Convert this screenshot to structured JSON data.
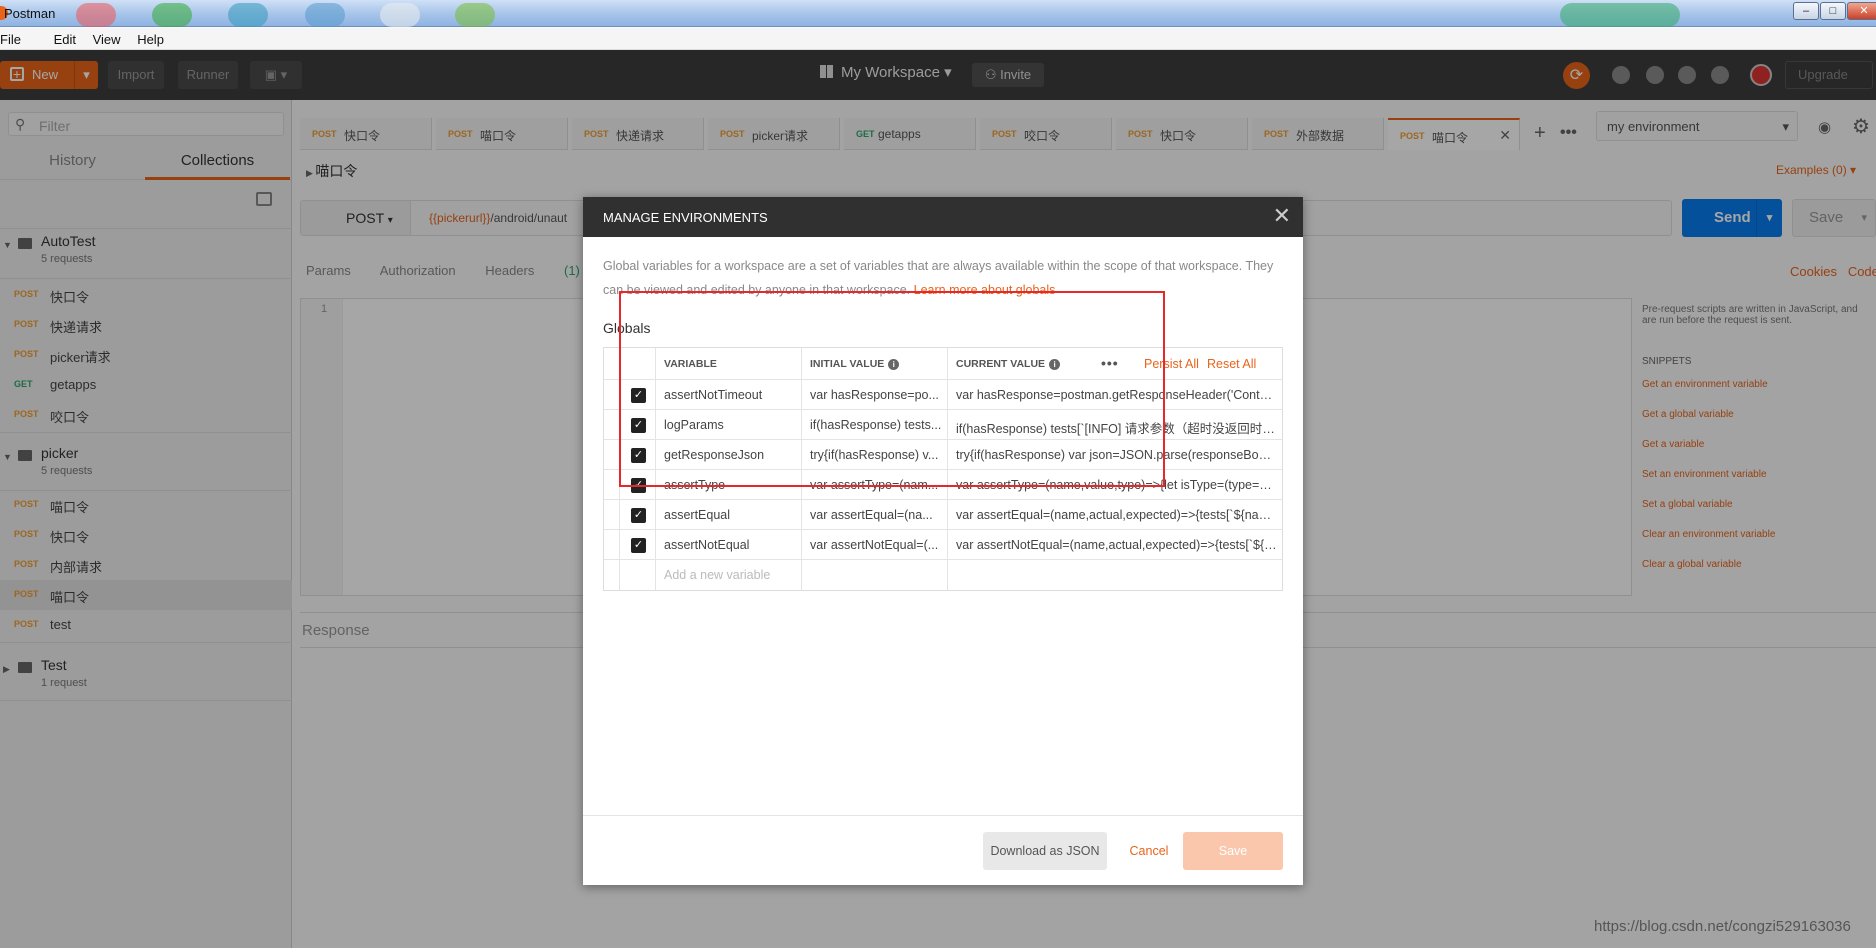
{
  "window": {
    "title": "Postman"
  },
  "menu": [
    "File",
    "Edit",
    "View",
    "Help"
  ],
  "toolbar": {
    "new_label": "New",
    "import_label": "Import",
    "runner_label": "Runner",
    "workspace_label": "My Workspace",
    "invite_label": "Invite",
    "upgrade_label": "Upgrade"
  },
  "sidebar": {
    "filter_placeholder": "Filter",
    "tabs": [
      "History",
      "Collections"
    ],
    "collections": [
      {
        "name": "AutoTest",
        "count": "5 requests",
        "requests": [
          {
            "method": "POST",
            "name": "快口令"
          },
          {
            "method": "POST",
            "name": "快递请求"
          },
          {
            "method": "POST",
            "name": "picker请求"
          },
          {
            "method": "GET",
            "name": "getapps"
          },
          {
            "method": "POST",
            "name": "咬口令"
          }
        ]
      },
      {
        "name": "picker",
        "count": "5 requests",
        "requests": [
          {
            "method": "POST",
            "name": "喵口令"
          },
          {
            "method": "POST",
            "name": "快口令"
          },
          {
            "method": "POST",
            "name": "内部请求"
          },
          {
            "method": "POST",
            "name": "喵口令"
          },
          {
            "method": "POST",
            "name": "test"
          }
        ]
      },
      {
        "name": "Test",
        "count": "1 request",
        "requests": []
      }
    ]
  },
  "request_tabs": [
    {
      "method": "POST",
      "name": "快口令"
    },
    {
      "method": "POST",
      "name": "喵口令"
    },
    {
      "method": "POST",
      "name": "快递请求"
    },
    {
      "method": "POST",
      "name": "picker请求"
    },
    {
      "method": "GET",
      "name": "getapps"
    },
    {
      "method": "POST",
      "name": "咬口令"
    },
    {
      "method": "POST",
      "name": "快口令"
    },
    {
      "method": "POST",
      "name": "外部数据"
    },
    {
      "method": "POST",
      "name": "喵口令"
    }
  ],
  "environment_select": "my environment",
  "request": {
    "name": "喵口令",
    "examples_label": "Examples (0)",
    "method": "POST",
    "url_var": "{{pickerurl}}",
    "url_rest": "/android/unaut",
    "send_label": "Send",
    "save_label": "Save",
    "subtabs": [
      "Params",
      "Authorization",
      "Headers"
    ],
    "headers_count": "(1)",
    "cookies_label": "Cookies",
    "code_label": "Code",
    "line_number": "1",
    "response_label": "Response"
  },
  "snippets": {
    "intro": "Pre-request scripts are written in JavaScript, and are run before the request is sent.",
    "header": "SNIPPETS",
    "items": [
      "Get an environment variable",
      "Get a global variable",
      "Get a variable",
      "Set an environment variable",
      "Set a global variable",
      "Clear an environment variable",
      "Clear a global variable"
    ]
  },
  "modal": {
    "title": "MANAGE ENVIRONMENTS",
    "description": "Global variables for a workspace are a set of variables that are always available within the scope of that workspace. They can be viewed and edited by anyone in that workspace.",
    "learn_more": "Learn more about globals",
    "section_title": "Globals",
    "columns": {
      "variable": "VARIABLE",
      "initial": "INITIAL VALUE",
      "current": "CURRENT VALUE"
    },
    "persist_all": "Persist All",
    "reset_all": "Reset All",
    "rows": [
      {
        "variable": "assertNotTimeout",
        "initial": "var hasResponse=po...",
        "current": "var hasResponse=postman.getResponseHeader('Conten..."
      },
      {
        "variable": "logParams",
        "initial": "if(hasResponse) tests...",
        "current": "if(hasResponse) tests[`[INFO] 请求参数（超时没返回时不..."
      },
      {
        "variable": "getResponseJson",
        "initial": "try{if(hasResponse) v...",
        "current": "try{if(hasResponse) var json=JSON.parse(responseBody);..."
      },
      {
        "variable": "assertType",
        "initial": "var assertType=(nam...",
        "current": "var assertType=(name,value,type)=>{let isType=(type==='..."
      },
      {
        "variable": "assertEqual",
        "initial": "var assertEqual=(na...",
        "current": "var assertEqual=(name,actual,expected)=>{tests[`${nam..."
      },
      {
        "variable": "assertNotEqual",
        "initial": "var assertNotEqual=(...",
        "current": "var assertNotEqual=(name,actual,expected)=>{tests[`${n..."
      }
    ],
    "add_placeholder": "Add a new variable",
    "download_label": "Download as JSON",
    "cancel_label": "Cancel",
    "save_label": "Save"
  },
  "watermark": "https://blog.csdn.net/congzi529163036"
}
